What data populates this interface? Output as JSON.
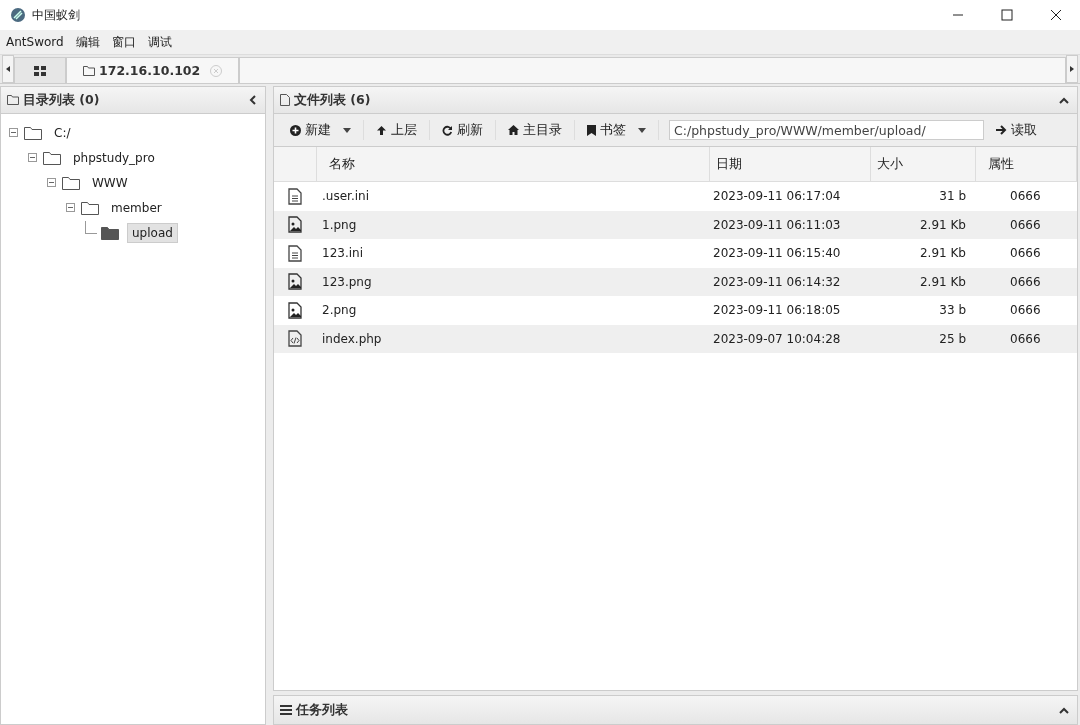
{
  "window": {
    "title": "中国蚁剑"
  },
  "menu": [
    "AntSword",
    "编辑",
    "窗口",
    "调试"
  ],
  "tabs": [
    {
      "kind": "home",
      "selected": false
    },
    {
      "kind": "folder",
      "label": "172.16.10.102",
      "selected": true
    }
  ],
  "directory_panel": {
    "title": "目录列表 (0)",
    "tree": [
      {
        "label": "C:/",
        "expanded": true,
        "selected": false,
        "children": [
          {
            "label": "phpstudy_pro",
            "expanded": true,
            "selected": false,
            "children": [
              {
                "label": "WWW",
                "expanded": true,
                "selected": false,
                "children": [
                  {
                    "label": "member",
                    "expanded": true,
                    "selected": false,
                    "children": [
                      {
                        "label": "upload",
                        "selected": true
                      }
                    ]
                  }
                ]
              }
            ]
          }
        ]
      }
    ]
  },
  "file_panel": {
    "title": "文件列表 (6)",
    "toolbar": [
      {
        "kind": "new",
        "label": "新建",
        "dropdown": true
      },
      {
        "kind": "up",
        "label": "上层",
        "dropdown": false
      },
      {
        "kind": "refresh",
        "label": "刷新",
        "dropdown": false
      },
      {
        "kind": "home",
        "label": "主目录",
        "dropdown": false
      },
      {
        "kind": "bookmark",
        "label": "书签",
        "dropdown": true
      }
    ],
    "path": "C:/phpstudy_pro/WWW/member/upload/",
    "read_button": "读取",
    "columns": [
      "名称",
      "日期",
      "大小",
      "属性"
    ],
    "rows": [
      {
        "kind": "text",
        "name": ".user.ini",
        "date": "2023-09-11 06:17:04",
        "size": "31 b",
        "attr": "0666"
      },
      {
        "kind": "image",
        "name": "1.png",
        "date": "2023-09-11 06:11:03",
        "size": "2.91 Kb",
        "attr": "0666"
      },
      {
        "kind": "text",
        "name": "123.ini",
        "date": "2023-09-11 06:15:40",
        "size": "2.91 Kb",
        "attr": "0666"
      },
      {
        "kind": "image",
        "name": "123.png",
        "date": "2023-09-11 06:14:32",
        "size": "2.91 Kb",
        "attr": "0666"
      },
      {
        "kind": "image",
        "name": "2.png",
        "date": "2023-09-11 06:18:05",
        "size": "33 b",
        "attr": "0666"
      },
      {
        "kind": "code",
        "name": "index.php",
        "date": "2023-09-07 10:04:28",
        "size": "25 b",
        "attr": "0666"
      }
    ]
  },
  "task_panel": {
    "title": "任务列表"
  }
}
